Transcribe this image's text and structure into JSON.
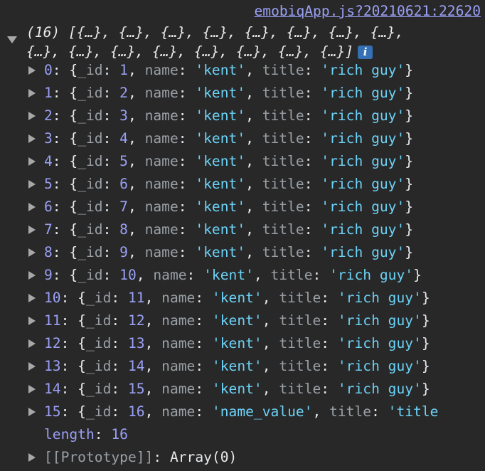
{
  "source_link": "emobiqApp.js?20210621:22620",
  "summary": {
    "count_label": "(16)",
    "line1": "[{…}, {…}, {…}, {…}, {…}, {…}, {…}, {…},",
    "line2": "{…}, {…}, {…}, {…}, {…}, {…}, {…}, {…}]",
    "info_glyph": "i"
  },
  "entries": [
    {
      "index": "0",
      "id": "1",
      "name": "'kent'",
      "title": "'rich guy'"
    },
    {
      "index": "1",
      "id": "2",
      "name": "'kent'",
      "title": "'rich guy'"
    },
    {
      "index": "2",
      "id": "3",
      "name": "'kent'",
      "title": "'rich guy'"
    },
    {
      "index": "3",
      "id": "4",
      "name": "'kent'",
      "title": "'rich guy'"
    },
    {
      "index": "4",
      "id": "5",
      "name": "'kent'",
      "title": "'rich guy'"
    },
    {
      "index": "5",
      "id": "6",
      "name": "'kent'",
      "title": "'rich guy'"
    },
    {
      "index": "6",
      "id": "7",
      "name": "'kent'",
      "title": "'rich guy'"
    },
    {
      "index": "7",
      "id": "8",
      "name": "'kent'",
      "title": "'rich guy'"
    },
    {
      "index": "8",
      "id": "9",
      "name": "'kent'",
      "title": "'rich guy'"
    },
    {
      "index": "9",
      "id": "10",
      "name": "'kent'",
      "title": "'rich guy'"
    },
    {
      "index": "10",
      "id": "11",
      "name": "'kent'",
      "title": "'rich guy'"
    },
    {
      "index": "11",
      "id": "12",
      "name": "'kent'",
      "title": "'rich guy'"
    },
    {
      "index": "12",
      "id": "13",
      "name": "'kent'",
      "title": "'rich guy'"
    },
    {
      "index": "13",
      "id": "14",
      "name": "'kent'",
      "title": "'rich guy'"
    },
    {
      "index": "14",
      "id": "15",
      "name": "'kent'",
      "title": "'rich guy'"
    },
    {
      "index": "15",
      "id": "16",
      "name": "'name_value'",
      "title": "'title"
    }
  ],
  "labels": {
    "id_key": "_id",
    "name_key": "name",
    "title_key": "title",
    "length_key": "length",
    "length_value": "16",
    "prototype_key": "[[Prototype]]",
    "prototype_value": "Array(0)"
  },
  "colors": {
    "background": "#282828",
    "index": "#9aa0f5",
    "key": "#9aa0a6",
    "number": "#9aa0f5",
    "string": "#6cd2f7",
    "link": "#9aa0f5",
    "info_badge": "#3570b5"
  },
  "icons": {
    "expand": "triangle-right-icon",
    "collapse": "triangle-down-icon",
    "info": "info-icon"
  }
}
